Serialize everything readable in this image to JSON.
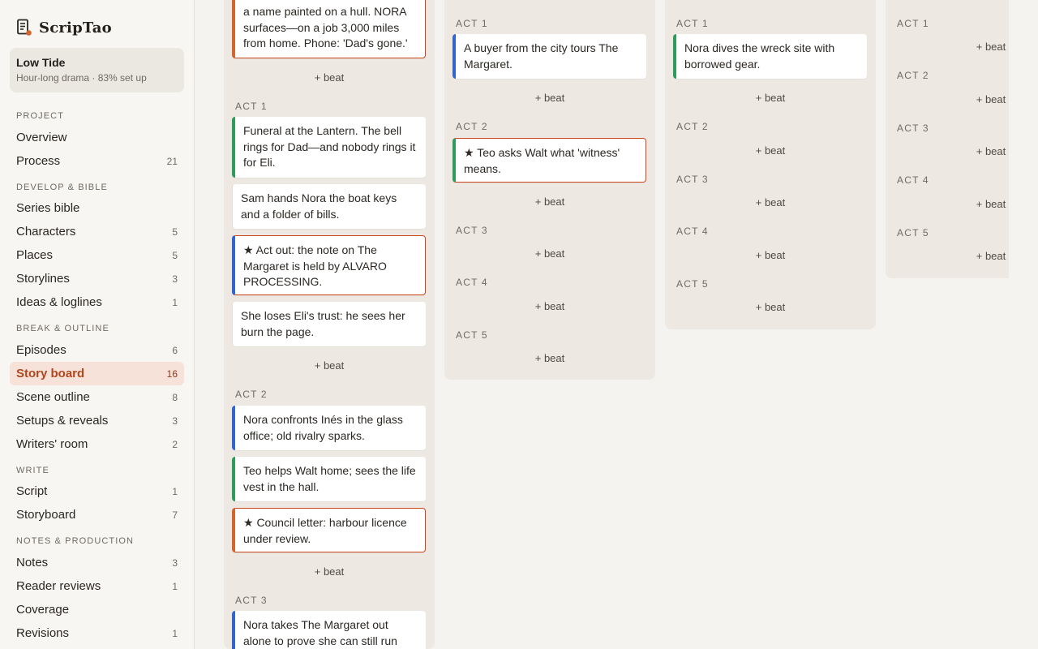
{
  "app": {
    "name": "ScripTao"
  },
  "project": {
    "name": "Low Tide",
    "meta": "Hour-long drama · 83% set up"
  },
  "sidebar": {
    "sections": [
      "PROJECT",
      "DEVELOP & BIBLE",
      "BREAK & OUTLINE",
      "WRITE",
      "NOTES & PRODUCTION"
    ],
    "items": [
      {
        "label": "Overview",
        "count": ""
      },
      {
        "label": "Process",
        "count": "21"
      },
      {
        "label": "Series bible",
        "count": ""
      },
      {
        "label": "Characters",
        "count": "5"
      },
      {
        "label": "Places",
        "count": "5"
      },
      {
        "label": "Storylines",
        "count": "3"
      },
      {
        "label": "Ideas & loglines",
        "count": "1"
      },
      {
        "label": "Episodes",
        "count": "6"
      },
      {
        "label": "Story board",
        "count": "16",
        "active": true
      },
      {
        "label": "Scene outline",
        "count": "8"
      },
      {
        "label": "Setups & reveals",
        "count": "3"
      },
      {
        "label": "Writers' room",
        "count": "2"
      },
      {
        "label": "Script",
        "count": "1"
      },
      {
        "label": "Storyboard",
        "count": "7"
      },
      {
        "label": "Notes",
        "count": "3"
      },
      {
        "label": "Reader reviews",
        "count": "1"
      },
      {
        "label": "Coverage",
        "count": ""
      },
      {
        "label": "Revisions",
        "count": "1"
      }
    ]
  },
  "board": {
    "add_beat_label": "+ beat",
    "acts": [
      "ACT 1",
      "ACT 2",
      "ACT 3",
      "ACT 4",
      "ACT 5"
    ],
    "col1": {
      "cold_open_card": "a name painted on a hull. NORA surfaces—on a job 3,000 miles from home. Phone: 'Dad's gone.'",
      "act1": [
        "Funeral at the Lantern. The bell rings for Dad—and nobody rings it for Eli.",
        "Sam hands Nora the boat keys and a folder of bills.",
        "★ Act out: the note on The Margaret is held by ALVARO PROCESSING.",
        "She loses Eli's trust: he sees her burn the page."
      ],
      "act2": [
        "Nora confronts Inés in the glass office; old rivalry sparks.",
        "Teo helps Walt home; sees the life vest in the hall.",
        "★ Council letter: harbour licence under review."
      ],
      "act3": [
        "Nora takes The Margaret out alone to prove she can still run"
      ]
    },
    "col2": {
      "act1": [
        "A buyer from the city tours The Margaret."
      ],
      "act2": [
        "★ Teo asks Walt what 'witness' means."
      ]
    },
    "col3": {
      "act1": [
        "Nora dives the wreck site with borrowed gear."
      ]
    }
  }
}
